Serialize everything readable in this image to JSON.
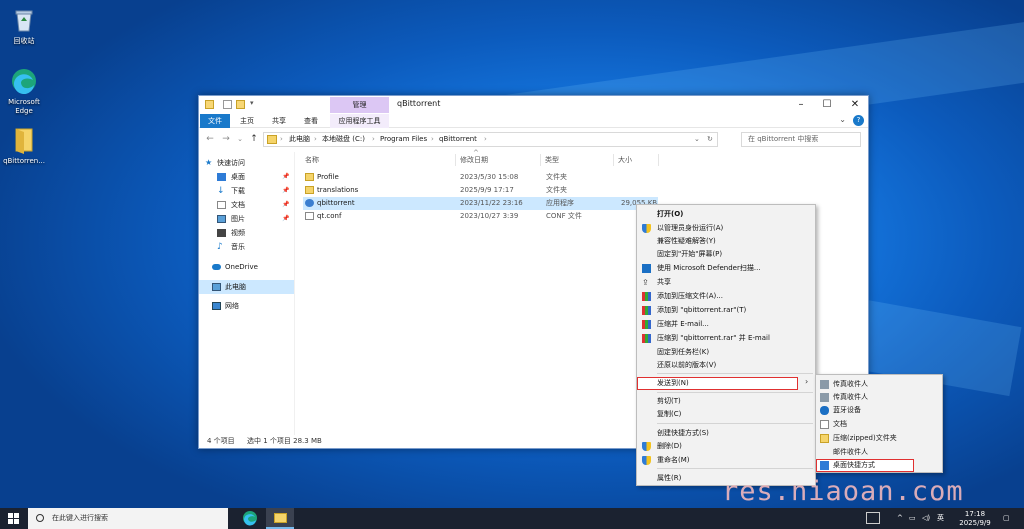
{
  "desktop": {
    "icons": [
      {
        "label": "回收站"
      },
      {
        "label": "Microsoft Edge"
      },
      {
        "label": "qBittorren..."
      }
    ]
  },
  "window": {
    "title": "qBittorrent",
    "context_tab": "管理",
    "tabs": [
      "文件",
      "主页",
      "共享",
      "查看",
      "应用程序工具"
    ],
    "breadcrumb": [
      "此电脑",
      "本地磁盘 (C:)",
      "Program Files",
      "qBittorrent"
    ],
    "search_placeholder": "在 qBittorrent 中搜索",
    "sidebar": [
      {
        "label": "快速访问"
      },
      {
        "label": "桌面"
      },
      {
        "label": "下载"
      },
      {
        "label": "文档"
      },
      {
        "label": "图片"
      },
      {
        "label": "视频"
      },
      {
        "label": "音乐"
      },
      {
        "label": "OneDrive"
      },
      {
        "label": "此电脑"
      },
      {
        "label": "网络"
      }
    ],
    "columns": [
      "名称",
      "修改日期",
      "类型",
      "大小"
    ],
    "files": [
      {
        "name": "Profile",
        "date": "2023/5/30 15:08",
        "type": "文件夹",
        "size": ""
      },
      {
        "name": "translations",
        "date": "2025/9/9 17:17",
        "type": "文件夹",
        "size": ""
      },
      {
        "name": "qbittorrent",
        "date": "2023/11/22 23:16",
        "type": "应用程序",
        "size": "29,055 KB"
      },
      {
        "name": "qt.conf",
        "date": "2023/10/27 3:39",
        "type": "CONF 文件",
        "size": ""
      }
    ],
    "status": {
      "count": "4 个项目",
      "selected": "选中 1 个项目  28.3 MB"
    }
  },
  "context_menu": {
    "items": [
      {
        "label": "打开(O)"
      },
      {
        "label": "以管理员身份运行(A)"
      },
      {
        "label": "兼容性疑难解答(Y)"
      },
      {
        "label": "固定到\"开始\"屏幕(P)"
      },
      {
        "label": "使用 Microsoft Defender扫描..."
      },
      {
        "label": "共享"
      },
      {
        "label": "添加到压缩文件(A)..."
      },
      {
        "label": "添加到 \"qbittorrent.rar\"(T)"
      },
      {
        "label": "压缩并 E-mail..."
      },
      {
        "label": "压缩到 \"qbittorrent.rar\" 并 E-mail"
      },
      {
        "label": "固定到任务栏(K)"
      },
      {
        "label": "还原以前的版本(V)"
      },
      {
        "label": "发送到(N)"
      },
      {
        "label": "剪切(T)"
      },
      {
        "label": "复制(C)"
      },
      {
        "label": "创建快捷方式(S)"
      },
      {
        "label": "删除(D)"
      },
      {
        "label": "重命名(M)"
      },
      {
        "label": "属性(R)"
      }
    ]
  },
  "send_to_menu": {
    "items": [
      {
        "label": "传真收件人"
      },
      {
        "label": "传真收件人"
      },
      {
        "label": "蓝牙设备"
      },
      {
        "label": "文档"
      },
      {
        "label": "压缩(zipped)文件夹"
      },
      {
        "label": "邮件收件人"
      },
      {
        "label": "桌面快捷方式"
      }
    ]
  },
  "watermark": "res.niaoan.com",
  "taskbar": {
    "search_placeholder": "在此键入进行搜索",
    "ime": "英",
    "time": "17:18",
    "date": "2025/9/9"
  },
  "colors": {
    "accent": "#1979ca",
    "highlight": "#e03030",
    "selection": "#cce8ff"
  }
}
